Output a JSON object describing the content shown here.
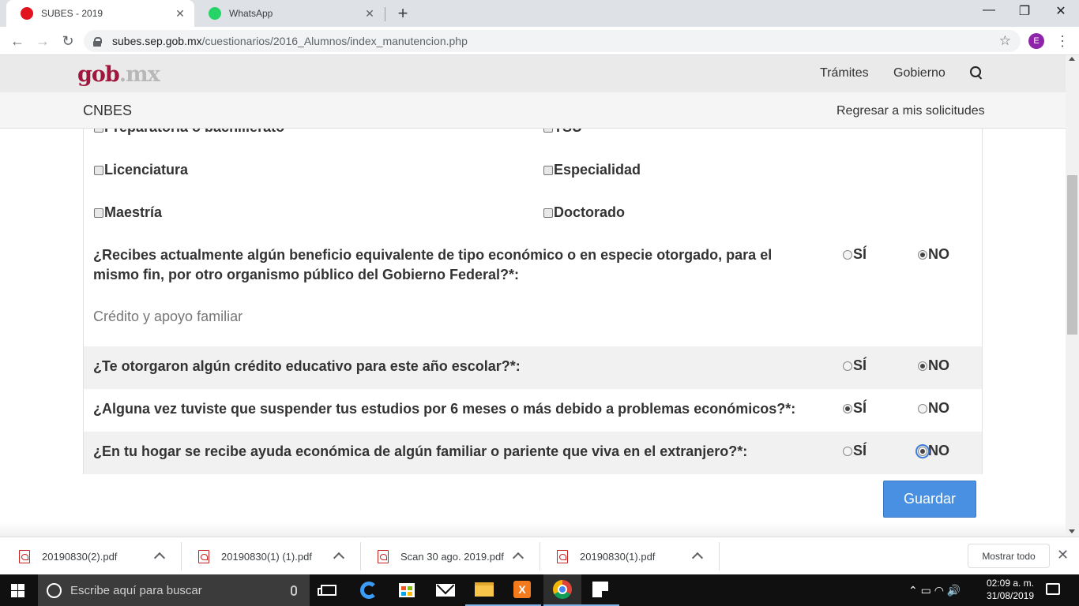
{
  "browser": {
    "tabs": [
      {
        "title": "SUBES - 2019",
        "favicon_color": "#e0131e",
        "active": true
      },
      {
        "title": "WhatsApp",
        "favicon_color": "#25d366",
        "active": false
      }
    ],
    "tab_close_symbol": "✕",
    "new_tab_symbol": "+",
    "window_controls": {
      "minimize": "—",
      "restore": "❐",
      "close": "✕"
    },
    "nav": {
      "back": "←",
      "forward": "→",
      "reload": "↻"
    },
    "url": {
      "domain": "subes.sep.gob.mx",
      "path": "/cuestionarios/2016_Alumnos/index_manutencion.php"
    },
    "bookmark_symbol": "☆",
    "profile_initial": "E",
    "menu_symbol": "⋮"
  },
  "site": {
    "logo": {
      "part1": "gob",
      "part2": ".mx"
    },
    "nav": {
      "tramites": "Trámites",
      "gobierno": "Gobierno"
    },
    "section_title": "CNBES",
    "back_link": "Regresar a mis solicitudes",
    "brand_color": "#a0163d"
  },
  "form": {
    "education_levels": {
      "row0": {
        "left": "Preparatoria o bachillerato",
        "right": "TSU"
      },
      "row1": {
        "left": "Licenciatura",
        "right": "Especialidad"
      },
      "row2": {
        "left": "Maestría",
        "right": "Doctorado"
      }
    },
    "questions": {
      "q1": {
        "text": "¿Recibes actualmente algún beneficio equivalente de tipo económico o en especie otorgado, para el mismo fin, por otro organismo público del Gobierno Federal?*:",
        "selected": "NO"
      },
      "q2": {
        "text": "¿Te otorgaron algún crédito educativo para este año escolar?*:",
        "selected": "NO"
      },
      "q3": {
        "text": "¿Alguna vez tuviste que suspender tus estudios por 6 meses o más debido a problemas económicos?*:",
        "selected": "SÍ"
      },
      "q4": {
        "text": "¿En tu hogar se recibe ayuda económica de algún familiar o pariente que viva en el extranjero?*:",
        "selected": "NO"
      }
    },
    "option_yes": "SÍ",
    "option_no": "NO",
    "section_text": "Crédito y apoyo familiar",
    "save_button": "Guardar",
    "button_color": "#4a90e2"
  },
  "downloads": {
    "items": [
      "20190830(2).pdf",
      "20190830(1) (1).pdf",
      "Scan 30 ago. 2019.pdf",
      "20190830(1).pdf"
    ],
    "show_all": "Mostrar todo",
    "close_symbol": "✕"
  },
  "taskbar": {
    "search_placeholder": "Escribe aquí para buscar",
    "time": "02:09 a. m.",
    "date": "31/08/2019",
    "tray_icons": "⌃  ▭  ◠  🔊"
  }
}
